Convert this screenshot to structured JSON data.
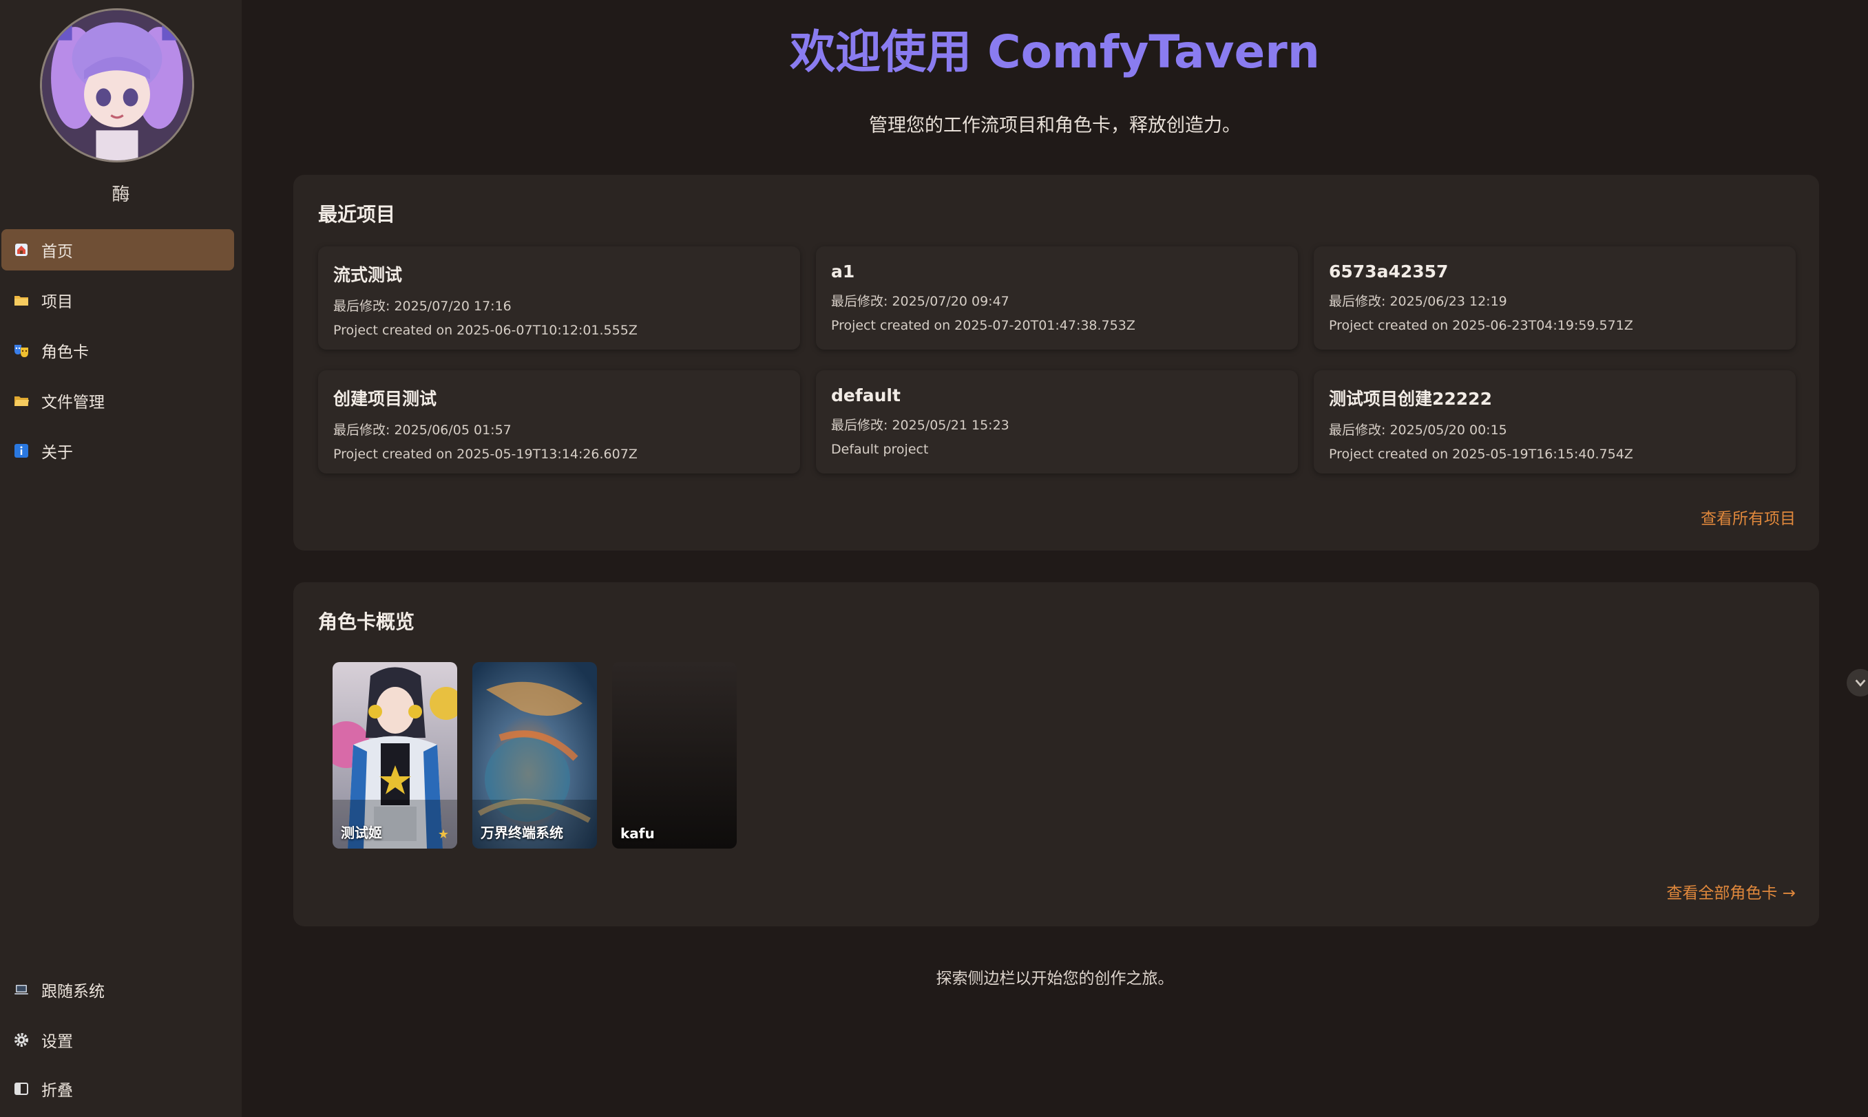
{
  "sidebar": {
    "username": "酶",
    "nav": [
      {
        "label": "首页",
        "icon": "home-icon",
        "active": true
      },
      {
        "label": "项目",
        "icon": "folder-icon"
      },
      {
        "label": "角色卡",
        "icon": "theater-masks-icon"
      },
      {
        "label": "文件管理",
        "icon": "folder-open-icon"
      },
      {
        "label": "关于",
        "icon": "info-icon"
      }
    ],
    "bottom": [
      {
        "label": "跟随系统",
        "icon": "laptop-icon"
      },
      {
        "label": "设置",
        "icon": "gear-icon"
      },
      {
        "label": "折叠",
        "icon": "collapse-sidebar-icon"
      }
    ]
  },
  "header": {
    "title": "欢迎使用 ComfyTavern",
    "subtitle": "管理您的工作流项目和角色卡，释放创造力。"
  },
  "recent": {
    "title": "最近项目",
    "projects": [
      {
        "name": "流式测试",
        "modified": "最后修改: 2025/07/20 17:16",
        "desc": "Project created on 2025-06-07T10:12:01.555Z"
      },
      {
        "name": "a1",
        "modified": "最后修改: 2025/07/20 09:47",
        "desc": "Project created on 2025-07-20T01:47:38.753Z"
      },
      {
        "name": "6573a42357",
        "modified": "最后修改: 2025/06/23 12:19",
        "desc": "Project created on 2025-06-23T04:19:59.571Z"
      },
      {
        "name": "创建项目测试",
        "modified": "最后修改: 2025/06/05 01:57",
        "desc": "Project created on 2025-05-19T13:14:26.607Z"
      },
      {
        "name": "default",
        "modified": "最后修改: 2025/05/21 15:23",
        "desc": "Default project"
      },
      {
        "name": "测试项目创建22222",
        "modified": "最后修改: 2025/05/20 00:15",
        "desc": "Project created on 2025-05-19T16:15:40.754Z"
      }
    ],
    "view_all": "查看所有项目"
  },
  "characters": {
    "title": "角色卡概览",
    "cards": [
      {
        "name": "测试姬",
        "favorite": "★"
      },
      {
        "name": "万界终端系统"
      },
      {
        "name": "kafu"
      }
    ],
    "view_all": "查看全部角色卡 →"
  },
  "footer": "探索侧边栏以开始您的创作之旅。",
  "colors": {
    "accent": "#e0883c",
    "title": "#8a7cf0",
    "active_nav": "#6f4f35"
  }
}
